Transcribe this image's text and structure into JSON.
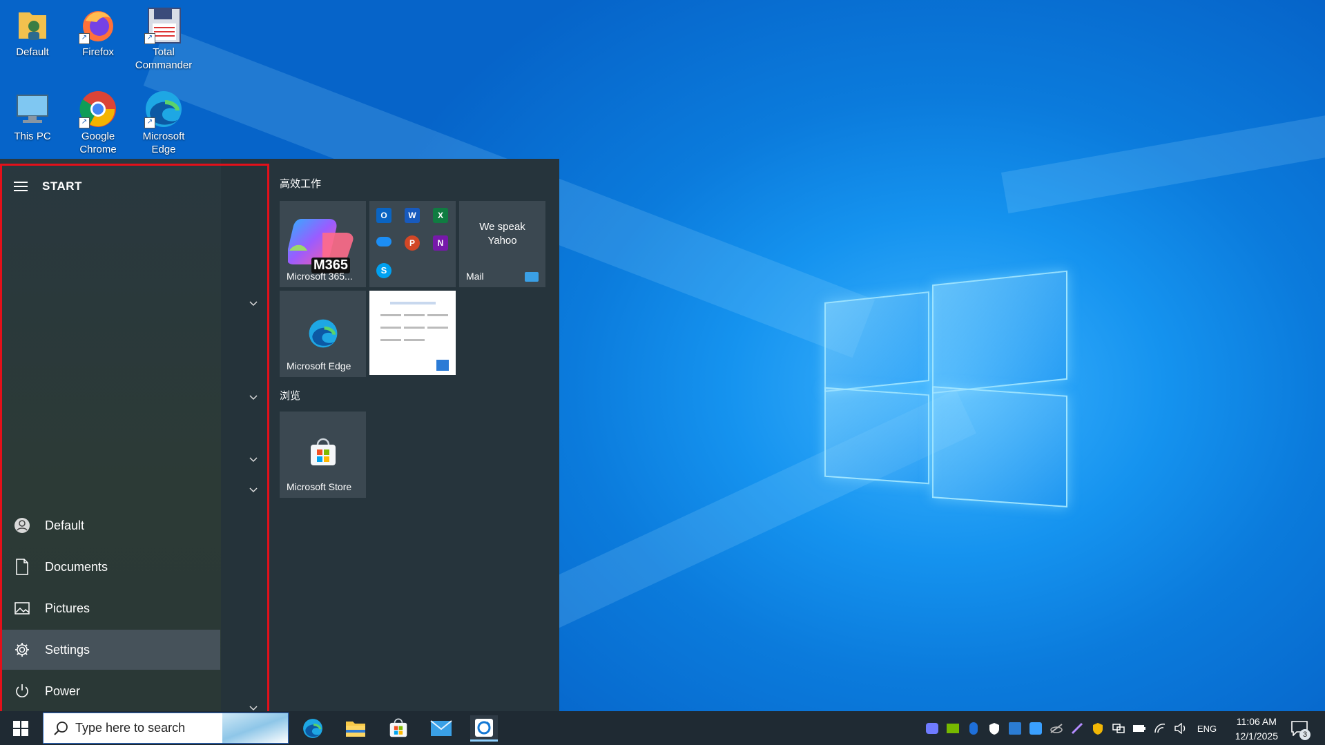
{
  "desktop": {
    "icons": [
      {
        "label": "Default"
      },
      {
        "label": "Firefox"
      },
      {
        "label": "Total Commander"
      },
      {
        "label": "This PC"
      },
      {
        "label": "Google Chrome"
      },
      {
        "label": "Microsoft Edge"
      }
    ]
  },
  "start_menu": {
    "title": "START",
    "nav": {
      "user": "Default",
      "documents": "Documents",
      "pictures": "Pictures",
      "settings": "Settings",
      "power": "Power"
    },
    "groups": [
      {
        "label": "高效工作"
      },
      {
        "label": "浏览"
      }
    ],
    "tiles": {
      "m365_label": "Microsoft 365...",
      "m365_badge": "M365",
      "mail_text": "We speak Yahoo",
      "mail_label": "Mail",
      "edge_label": "Microsoft Edge",
      "store_label": "Microsoft Store"
    }
  },
  "taskbar": {
    "search_placeholder": "Type here to search",
    "language": "ENG",
    "time": "11:06 AM",
    "date": "12/1/2025",
    "notification_count": "3"
  },
  "colors": {
    "accent_red_border": "#e3101a",
    "taskbar_bg": "#1f2a33",
    "start_bg": "#26343c"
  }
}
